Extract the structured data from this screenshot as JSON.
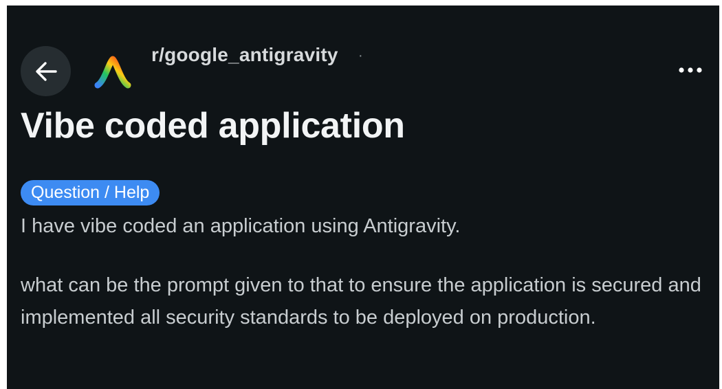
{
  "header": {
    "community_name": "r/google_antigravity",
    "separator": "·",
    "back_icon": "arrow-left-icon",
    "more_icon": "more-horizontal-icon",
    "community_icon": "antigravity-logo"
  },
  "post": {
    "title": "Vibe coded application",
    "flair": "Question / Help",
    "paragraphs": [
      "I have vibe coded an application using Antigravity.",
      "what can be the prompt given to that to ensure the application is secured and implemented all security standards to be deployed on production."
    ]
  },
  "colors": {
    "background": "#0f1417",
    "flair_background": "#3d8bf2",
    "title_text": "#f2f4f5",
    "body_text": "#c8cdd0"
  }
}
